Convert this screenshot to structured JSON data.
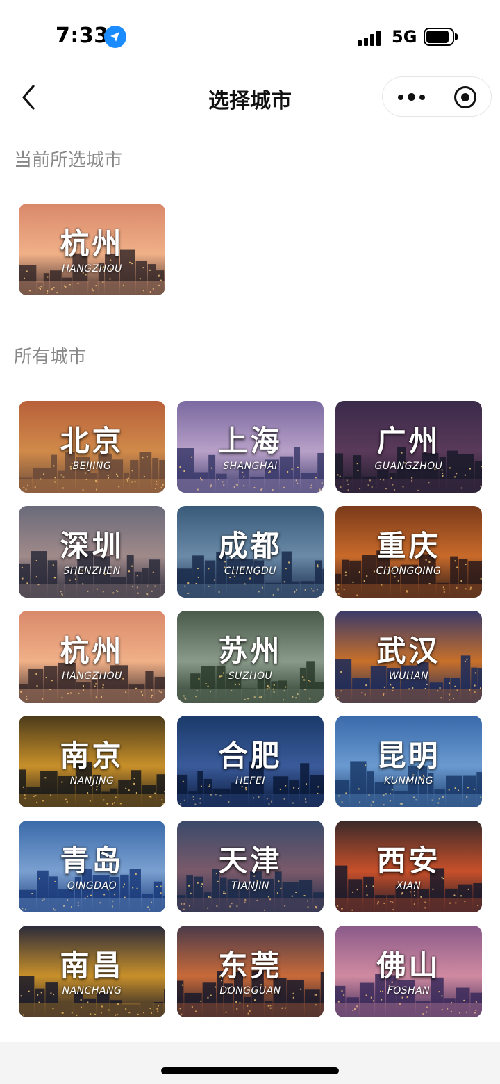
{
  "status_bar": {
    "time": "7:33",
    "network": "5G",
    "location_icon": "location-arrow-icon",
    "signal_icon": "cellular-signal-icon",
    "battery_icon": "battery-icon"
  },
  "nav": {
    "title": "选择城市",
    "back_icon": "chevron-left-icon",
    "more_icon": "more-dots-icon",
    "close_icon": "target-close-icon"
  },
  "current": {
    "label": "当前所选城市",
    "city": {
      "name": "杭州",
      "pinyin": "HANGZHOU",
      "colors": [
        "#3a2a2a",
        "#d9896a",
        "#f0b088"
      ]
    }
  },
  "all": {
    "label": "所有城市",
    "cities": [
      {
        "name": "北京",
        "pinyin": "BEIJING",
        "colors": [
          "#6a4a3a",
          "#b8603a",
          "#d08a4a"
        ]
      },
      {
        "name": "上海",
        "pinyin": "SHANGHAI",
        "colors": [
          "#3a3a6a",
          "#7a6aa0",
          "#b8a0c8"
        ]
      },
      {
        "name": "广州",
        "pinyin": "GUANGZHOU",
        "colors": [
          "#1a1a2a",
          "#3a2a4a",
          "#5a3a5a"
        ]
      },
      {
        "name": "深圳",
        "pinyin": "SHENZHEN",
        "colors": [
          "#2a2a3a",
          "#6a6a7a",
          "#a08a8a"
        ]
      },
      {
        "name": "成都",
        "pinyin": "CHENGDU",
        "colors": [
          "#1a2a4a",
          "#3a5a7a",
          "#6a8aa8"
        ]
      },
      {
        "name": "重庆",
        "pinyin": "CHONGQING",
        "colors": [
          "#2a1a1a",
          "#7a3a1a",
          "#c86a2a"
        ]
      },
      {
        "name": "杭州",
        "pinyin": "HANGZHOU",
        "colors": [
          "#3a2a2a",
          "#d9896a",
          "#f0b088"
        ]
      },
      {
        "name": "苏州",
        "pinyin": "SUZHOU",
        "colors": [
          "#2a3a2a",
          "#4a5a4a",
          "#8a9a8a"
        ]
      },
      {
        "name": "武汉",
        "pinyin": "WUHAN",
        "colors": [
          "#1a2a5a",
          "#3a3a6a",
          "#c8702a"
        ]
      },
      {
        "name": "南京",
        "pinyin": "NANJING",
        "colors": [
          "#1a1a1a",
          "#4a3a1a",
          "#c8902a"
        ]
      },
      {
        "name": "合肥",
        "pinyin": "HEFEI",
        "colors": [
          "#0a1a3a",
          "#1a3a6a",
          "#3a5a9a"
        ]
      },
      {
        "name": "昆明",
        "pinyin": "KUNMING",
        "colors": [
          "#1a3a6a",
          "#3a6aaa",
          "#6a9ad0"
        ]
      },
      {
        "name": "青岛",
        "pinyin": "QINGDAO",
        "colors": [
          "#1a3a7a",
          "#3a6aaa",
          "#7aa0d0"
        ]
      },
      {
        "name": "天津",
        "pinyin": "TIANJIN",
        "colors": [
          "#1a2a4a",
          "#3a4a6a",
          "#7a5a6a"
        ]
      },
      {
        "name": "西安",
        "pinyin": "XIAN",
        "colors": [
          "#1a1a2a",
          "#3a2a2a",
          "#c8502a"
        ]
      },
      {
        "name": "南昌",
        "pinyin": "NANCHANG",
        "colors": [
          "#1a1a2a",
          "#2a2a3a",
          "#c8902a"
        ]
      },
      {
        "name": "东莞",
        "pinyin": "DONGGUAN",
        "colors": [
          "#1a1a2a",
          "#4a3a4a",
          "#c86a3a"
        ]
      },
      {
        "name": "佛山",
        "pinyin": "FOSHAN",
        "colors": [
          "#3a2a5a",
          "#8a5a8a",
          "#d08aa0"
        ]
      }
    ]
  }
}
